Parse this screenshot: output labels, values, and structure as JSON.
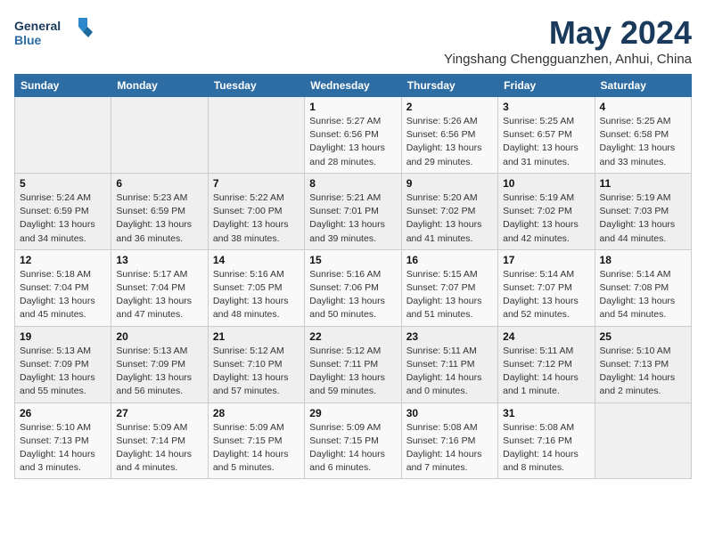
{
  "logo": {
    "line1": "General",
    "line2": "Blue"
  },
  "title": "May 2024",
  "subtitle": "Yingshang Chengguanzhen, Anhui, China",
  "weekdays": [
    "Sunday",
    "Monday",
    "Tuesday",
    "Wednesday",
    "Thursday",
    "Friday",
    "Saturday"
  ],
  "weeks": [
    [
      {
        "day": "",
        "info": ""
      },
      {
        "day": "",
        "info": ""
      },
      {
        "day": "",
        "info": ""
      },
      {
        "day": "1",
        "info": "Sunrise: 5:27 AM\nSunset: 6:56 PM\nDaylight: 13 hours\nand 28 minutes."
      },
      {
        "day": "2",
        "info": "Sunrise: 5:26 AM\nSunset: 6:56 PM\nDaylight: 13 hours\nand 29 minutes."
      },
      {
        "day": "3",
        "info": "Sunrise: 5:25 AM\nSunset: 6:57 PM\nDaylight: 13 hours\nand 31 minutes."
      },
      {
        "day": "4",
        "info": "Sunrise: 5:25 AM\nSunset: 6:58 PM\nDaylight: 13 hours\nand 33 minutes."
      }
    ],
    [
      {
        "day": "5",
        "info": "Sunrise: 5:24 AM\nSunset: 6:59 PM\nDaylight: 13 hours\nand 34 minutes."
      },
      {
        "day": "6",
        "info": "Sunrise: 5:23 AM\nSunset: 6:59 PM\nDaylight: 13 hours\nand 36 minutes."
      },
      {
        "day": "7",
        "info": "Sunrise: 5:22 AM\nSunset: 7:00 PM\nDaylight: 13 hours\nand 38 minutes."
      },
      {
        "day": "8",
        "info": "Sunrise: 5:21 AM\nSunset: 7:01 PM\nDaylight: 13 hours\nand 39 minutes."
      },
      {
        "day": "9",
        "info": "Sunrise: 5:20 AM\nSunset: 7:02 PM\nDaylight: 13 hours\nand 41 minutes."
      },
      {
        "day": "10",
        "info": "Sunrise: 5:19 AM\nSunset: 7:02 PM\nDaylight: 13 hours\nand 42 minutes."
      },
      {
        "day": "11",
        "info": "Sunrise: 5:19 AM\nSunset: 7:03 PM\nDaylight: 13 hours\nand 44 minutes."
      }
    ],
    [
      {
        "day": "12",
        "info": "Sunrise: 5:18 AM\nSunset: 7:04 PM\nDaylight: 13 hours\nand 45 minutes."
      },
      {
        "day": "13",
        "info": "Sunrise: 5:17 AM\nSunset: 7:04 PM\nDaylight: 13 hours\nand 47 minutes."
      },
      {
        "day": "14",
        "info": "Sunrise: 5:16 AM\nSunset: 7:05 PM\nDaylight: 13 hours\nand 48 minutes."
      },
      {
        "day": "15",
        "info": "Sunrise: 5:16 AM\nSunset: 7:06 PM\nDaylight: 13 hours\nand 50 minutes."
      },
      {
        "day": "16",
        "info": "Sunrise: 5:15 AM\nSunset: 7:07 PM\nDaylight: 13 hours\nand 51 minutes."
      },
      {
        "day": "17",
        "info": "Sunrise: 5:14 AM\nSunset: 7:07 PM\nDaylight: 13 hours\nand 52 minutes."
      },
      {
        "day": "18",
        "info": "Sunrise: 5:14 AM\nSunset: 7:08 PM\nDaylight: 13 hours\nand 54 minutes."
      }
    ],
    [
      {
        "day": "19",
        "info": "Sunrise: 5:13 AM\nSunset: 7:09 PM\nDaylight: 13 hours\nand 55 minutes."
      },
      {
        "day": "20",
        "info": "Sunrise: 5:13 AM\nSunset: 7:09 PM\nDaylight: 13 hours\nand 56 minutes."
      },
      {
        "day": "21",
        "info": "Sunrise: 5:12 AM\nSunset: 7:10 PM\nDaylight: 13 hours\nand 57 minutes."
      },
      {
        "day": "22",
        "info": "Sunrise: 5:12 AM\nSunset: 7:11 PM\nDaylight: 13 hours\nand 59 minutes."
      },
      {
        "day": "23",
        "info": "Sunrise: 5:11 AM\nSunset: 7:11 PM\nDaylight: 14 hours\nand 0 minutes."
      },
      {
        "day": "24",
        "info": "Sunrise: 5:11 AM\nSunset: 7:12 PM\nDaylight: 14 hours\nand 1 minute."
      },
      {
        "day": "25",
        "info": "Sunrise: 5:10 AM\nSunset: 7:13 PM\nDaylight: 14 hours\nand 2 minutes."
      }
    ],
    [
      {
        "day": "26",
        "info": "Sunrise: 5:10 AM\nSunset: 7:13 PM\nDaylight: 14 hours\nand 3 minutes."
      },
      {
        "day": "27",
        "info": "Sunrise: 5:09 AM\nSunset: 7:14 PM\nDaylight: 14 hours\nand 4 minutes."
      },
      {
        "day": "28",
        "info": "Sunrise: 5:09 AM\nSunset: 7:15 PM\nDaylight: 14 hours\nand 5 minutes."
      },
      {
        "day": "29",
        "info": "Sunrise: 5:09 AM\nSunset: 7:15 PM\nDaylight: 14 hours\nand 6 minutes."
      },
      {
        "day": "30",
        "info": "Sunrise: 5:08 AM\nSunset: 7:16 PM\nDaylight: 14 hours\nand 7 minutes."
      },
      {
        "day": "31",
        "info": "Sunrise: 5:08 AM\nSunset: 7:16 PM\nDaylight: 14 hours\nand 8 minutes."
      },
      {
        "day": "",
        "info": ""
      }
    ]
  ]
}
